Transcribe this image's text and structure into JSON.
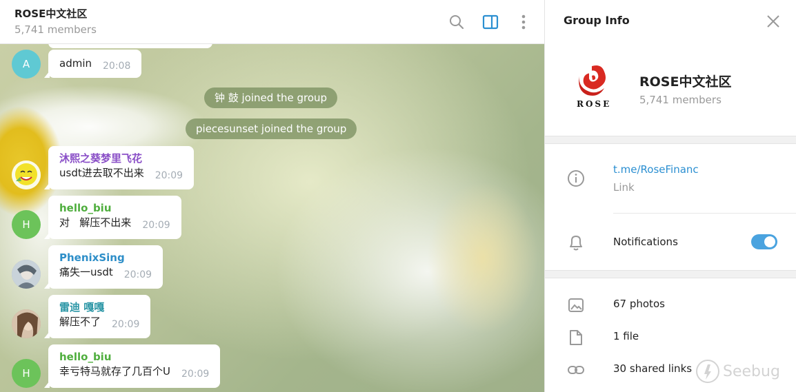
{
  "chat": {
    "title": "ROSE中文社区",
    "subtitle": "5,741 members",
    "header_icons": [
      "search-icon",
      "sidebar-toggle-icon",
      "more-vertical-icon"
    ]
  },
  "messages": [
    {
      "sender": "",
      "avatar_letter": "A",
      "avatar_color": "#5fc9d3",
      "text": "admin",
      "time": "20:08"
    },
    {
      "sender": "沐熙之葵梦里飞花",
      "sender_color": "#8a4fc7",
      "avatar_letter": "",
      "text": "usdt进去取不出来",
      "time": "20:09"
    },
    {
      "sender": "hello_biu",
      "sender_color": "#4fae3e",
      "avatar_letter": "H",
      "avatar_color": "#6cc35a",
      "text": "对   解压不出来",
      "time": "20:09"
    },
    {
      "sender": "PhenixSing",
      "sender_color": "#2d8ec8",
      "avatar_letter": "",
      "text": "痛失一usdt",
      "time": "20:09"
    },
    {
      "sender": "雷迪 嘎嘎",
      "sender_color": "#2b96a6",
      "avatar_letter": "",
      "text": "解压不了",
      "time": "20:09"
    },
    {
      "sender": "hello_biu",
      "sender_color": "#4fae3e",
      "avatar_letter": "H",
      "avatar_color": "#6cc35a",
      "text": "幸亏特马就存了几百个U",
      "time": "20:09"
    }
  ],
  "service_messages": [
    {
      "text": "钟 鼓 joined the group"
    },
    {
      "text": "piecesunset joined the group"
    }
  ],
  "panel": {
    "title": "Group Info",
    "group_name": "ROSE中文社区",
    "group_count": "5,741 members",
    "logo_text": "ROSE",
    "link_value": "t.me/RoseFinanc",
    "link_label": "Link",
    "notifications_label": "Notifications",
    "notifications_on": true,
    "media": [
      {
        "icon": "photo-icon",
        "label": "67 photos"
      },
      {
        "icon": "file-icon",
        "label": "1 file"
      },
      {
        "icon": "link-icon",
        "label": "30 shared links"
      }
    ],
    "watermark": "Seebug"
  },
  "colors": {
    "accent": "#2b8fd1",
    "toggle": "#4aa3df",
    "service_bg": "#748a5a"
  }
}
